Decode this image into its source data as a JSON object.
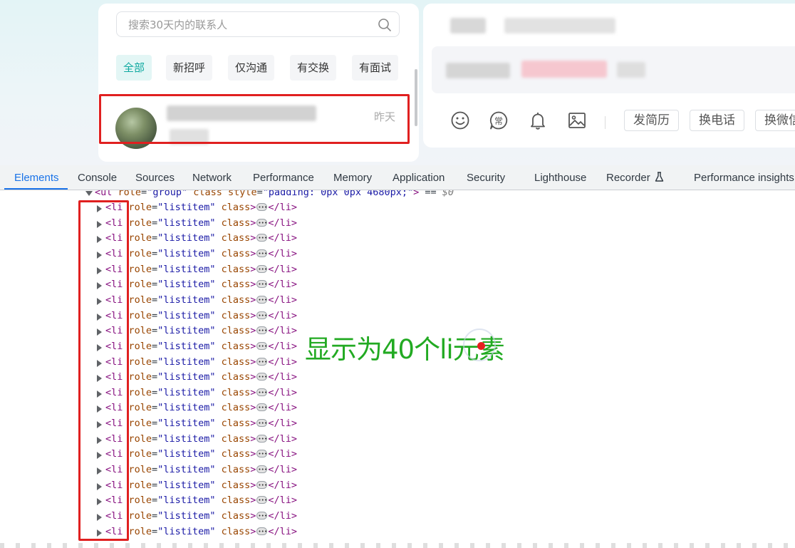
{
  "app": {
    "search": {
      "placeholder": "搜索30天内的联系人",
      "value": ""
    },
    "filters": [
      "全部",
      "新招呼",
      "仅沟通",
      "有交换",
      "有面试"
    ],
    "active_filter": "全部",
    "conversation": {
      "time": "昨天"
    },
    "toolbar": {
      "icons": [
        "emoji-icon",
        "common-phrases-icon",
        "bell-icon",
        "image-icon"
      ],
      "common_phrase_glyph": "常",
      "buttons": [
        "发简历",
        "换电话",
        "换微信"
      ]
    }
  },
  "devtools": {
    "tabs": [
      "Elements",
      "Console",
      "Sources",
      "Network",
      "Performance",
      "Memory",
      "Application",
      "Security",
      "Lighthouse",
      "Recorder",
      "Performance insights"
    ],
    "active_tab": "Elements",
    "ul_line": {
      "open": "<ul",
      "attr1": "role",
      "val1": "\"group\"",
      "attr2": "class",
      "attr3": "style",
      "val3": "\"padding: 0px 0px 4680px;\"",
      "close": ">",
      "eq": " == ",
      "dollar": "$0"
    },
    "li_line": {
      "open": "<li",
      "attr_role": "role",
      "role_value": "\"listitem\"",
      "attr_class": "class",
      "gt": ">",
      "close": "</li>"
    },
    "li_rows_visible": 22
  },
  "annotation": {
    "text": "显示为40个li元素"
  },
  "colors": {
    "highlight": "#e02020",
    "annotation": "#22aa22",
    "accent": "#0fa9a0",
    "devtools_active": "#1a73e8"
  }
}
